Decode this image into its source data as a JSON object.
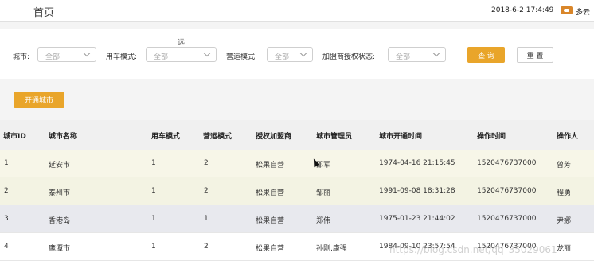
{
  "header": {
    "title": "首页",
    "datetime": "2018-6-2 17:4:49",
    "weather": "多云"
  },
  "filters": {
    "floating_char": "远",
    "city": {
      "label": "城市:",
      "value": "全部"
    },
    "car_mode": {
      "label": "用车模式:",
      "value": "全部"
    },
    "operation_mode": {
      "label": "营运模式:",
      "value": "全部"
    },
    "franchise_status": {
      "label": "加盟商授权状态:",
      "value": "全部"
    },
    "query_label": "查 询",
    "reset_label": "重 置"
  },
  "actions": {
    "open_city_label": "开通城市"
  },
  "table": {
    "headers": [
      "城市ID",
      "城市名称",
      "用车模式",
      "营运模式",
      "授权加盟商",
      "城市管理员",
      "城市开通时间",
      "操作时间",
      "操作人"
    ],
    "rows": [
      [
        "1",
        "延安市",
        "1",
        "2",
        "松果自营",
        "邵军",
        "1974-04-16 21:15:45",
        "1520476737000",
        "曾芳"
      ],
      [
        "2",
        "泰州市",
        "1",
        "2",
        "松果自营",
        "邹丽",
        "1991-09-08 18:31:28",
        "1520476737000",
        "程勇"
      ],
      [
        "3",
        "香港岛",
        "1",
        "1",
        "松果自营",
        "郑伟",
        "1975-01-23 21:44:02",
        "1520476737000",
        "尹娜"
      ],
      [
        "4",
        "鹰潭市",
        "1",
        "2",
        "松果自营",
        "孙刚,康强",
        "1984-09-10 23:57:54",
        "1520476737000",
        "龙丽"
      ]
    ]
  },
  "watermark": "https://blog.csdn.net/qq_35029061"
}
